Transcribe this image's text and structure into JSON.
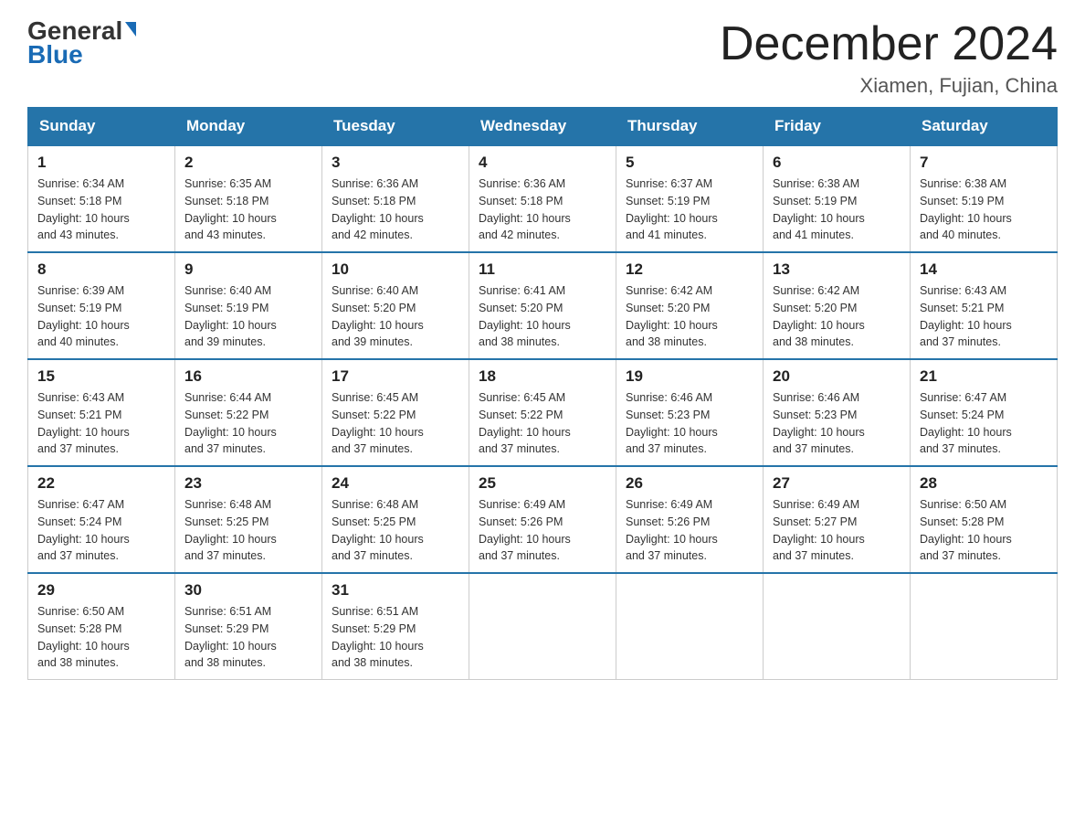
{
  "header": {
    "logo_part1": "General",
    "logo_part2": "Blue",
    "month_title": "December 2024",
    "location": "Xiamen, Fujian, China"
  },
  "days_of_week": [
    "Sunday",
    "Monday",
    "Tuesday",
    "Wednesday",
    "Thursday",
    "Friday",
    "Saturday"
  ],
  "weeks": [
    [
      {
        "day": "1",
        "sunrise": "6:34 AM",
        "sunset": "5:18 PM",
        "daylight": "10 hours and 43 minutes."
      },
      {
        "day": "2",
        "sunrise": "6:35 AM",
        "sunset": "5:18 PM",
        "daylight": "10 hours and 43 minutes."
      },
      {
        "day": "3",
        "sunrise": "6:36 AM",
        "sunset": "5:18 PM",
        "daylight": "10 hours and 42 minutes."
      },
      {
        "day": "4",
        "sunrise": "6:36 AM",
        "sunset": "5:18 PM",
        "daylight": "10 hours and 42 minutes."
      },
      {
        "day": "5",
        "sunrise": "6:37 AM",
        "sunset": "5:19 PM",
        "daylight": "10 hours and 41 minutes."
      },
      {
        "day": "6",
        "sunrise": "6:38 AM",
        "sunset": "5:19 PM",
        "daylight": "10 hours and 41 minutes."
      },
      {
        "day": "7",
        "sunrise": "6:38 AM",
        "sunset": "5:19 PM",
        "daylight": "10 hours and 40 minutes."
      }
    ],
    [
      {
        "day": "8",
        "sunrise": "6:39 AM",
        "sunset": "5:19 PM",
        "daylight": "10 hours and 40 minutes."
      },
      {
        "day": "9",
        "sunrise": "6:40 AM",
        "sunset": "5:19 PM",
        "daylight": "10 hours and 39 minutes."
      },
      {
        "day": "10",
        "sunrise": "6:40 AM",
        "sunset": "5:20 PM",
        "daylight": "10 hours and 39 minutes."
      },
      {
        "day": "11",
        "sunrise": "6:41 AM",
        "sunset": "5:20 PM",
        "daylight": "10 hours and 38 minutes."
      },
      {
        "day": "12",
        "sunrise": "6:42 AM",
        "sunset": "5:20 PM",
        "daylight": "10 hours and 38 minutes."
      },
      {
        "day": "13",
        "sunrise": "6:42 AM",
        "sunset": "5:20 PM",
        "daylight": "10 hours and 38 minutes."
      },
      {
        "day": "14",
        "sunrise": "6:43 AM",
        "sunset": "5:21 PM",
        "daylight": "10 hours and 37 minutes."
      }
    ],
    [
      {
        "day": "15",
        "sunrise": "6:43 AM",
        "sunset": "5:21 PM",
        "daylight": "10 hours and 37 minutes."
      },
      {
        "day": "16",
        "sunrise": "6:44 AM",
        "sunset": "5:22 PM",
        "daylight": "10 hours and 37 minutes."
      },
      {
        "day": "17",
        "sunrise": "6:45 AM",
        "sunset": "5:22 PM",
        "daylight": "10 hours and 37 minutes."
      },
      {
        "day": "18",
        "sunrise": "6:45 AM",
        "sunset": "5:22 PM",
        "daylight": "10 hours and 37 minutes."
      },
      {
        "day": "19",
        "sunrise": "6:46 AM",
        "sunset": "5:23 PM",
        "daylight": "10 hours and 37 minutes."
      },
      {
        "day": "20",
        "sunrise": "6:46 AM",
        "sunset": "5:23 PM",
        "daylight": "10 hours and 37 minutes."
      },
      {
        "day": "21",
        "sunrise": "6:47 AM",
        "sunset": "5:24 PM",
        "daylight": "10 hours and 37 minutes."
      }
    ],
    [
      {
        "day": "22",
        "sunrise": "6:47 AM",
        "sunset": "5:24 PM",
        "daylight": "10 hours and 37 minutes."
      },
      {
        "day": "23",
        "sunrise": "6:48 AM",
        "sunset": "5:25 PM",
        "daylight": "10 hours and 37 minutes."
      },
      {
        "day": "24",
        "sunrise": "6:48 AM",
        "sunset": "5:25 PM",
        "daylight": "10 hours and 37 minutes."
      },
      {
        "day": "25",
        "sunrise": "6:49 AM",
        "sunset": "5:26 PM",
        "daylight": "10 hours and 37 minutes."
      },
      {
        "day": "26",
        "sunrise": "6:49 AM",
        "sunset": "5:26 PM",
        "daylight": "10 hours and 37 minutes."
      },
      {
        "day": "27",
        "sunrise": "6:49 AM",
        "sunset": "5:27 PM",
        "daylight": "10 hours and 37 minutes."
      },
      {
        "day": "28",
        "sunrise": "6:50 AM",
        "sunset": "5:28 PM",
        "daylight": "10 hours and 37 minutes."
      }
    ],
    [
      {
        "day": "29",
        "sunrise": "6:50 AM",
        "sunset": "5:28 PM",
        "daylight": "10 hours and 38 minutes."
      },
      {
        "day": "30",
        "sunrise": "6:51 AM",
        "sunset": "5:29 PM",
        "daylight": "10 hours and 38 minutes."
      },
      {
        "day": "31",
        "sunrise": "6:51 AM",
        "sunset": "5:29 PM",
        "daylight": "10 hours and 38 minutes."
      },
      null,
      null,
      null,
      null
    ]
  ],
  "labels": {
    "sunrise": "Sunrise:",
    "sunset": "Sunset:",
    "daylight": "Daylight:"
  }
}
